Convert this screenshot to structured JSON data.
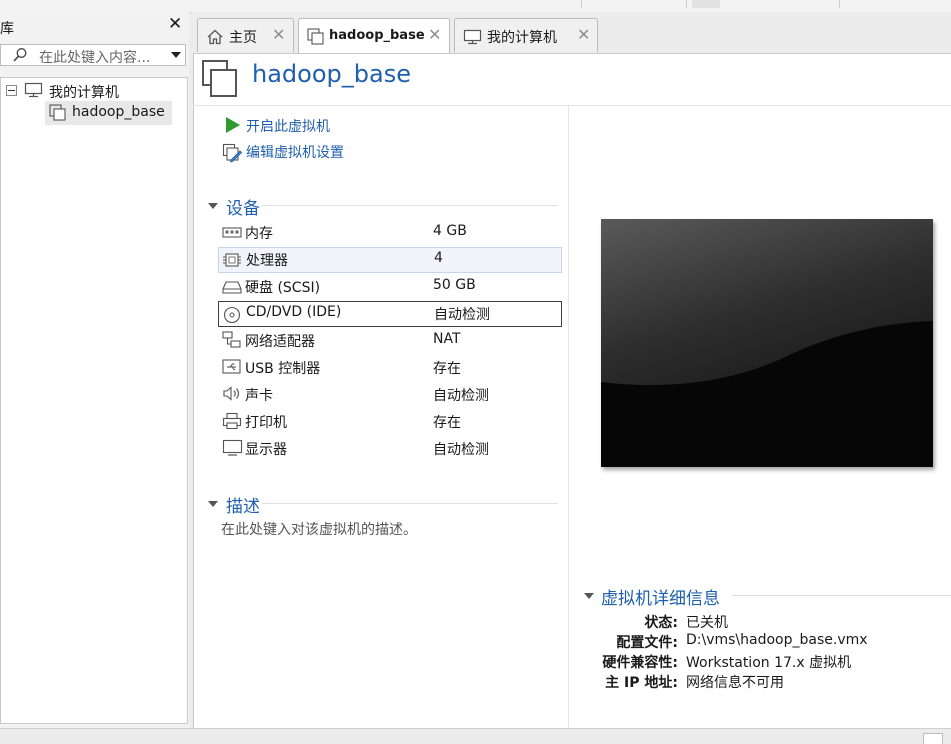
{
  "library": {
    "title": "库",
    "search_placeholder": "在此处键入内容...",
    "tree": {
      "root_label": "我的计算机",
      "children": [
        {
          "label": "hadoop_base"
        }
      ]
    }
  },
  "tabs": [
    {
      "label": "主页",
      "icon": "home-icon",
      "active": false
    },
    {
      "label": "hadoop_base",
      "icon": "vm-icon",
      "active": true
    },
    {
      "label": "我的计算机",
      "icon": "computer-icon",
      "active": false
    }
  ],
  "vm": {
    "title": "hadoop_base",
    "actions": {
      "start": "开启此虚拟机",
      "edit": "编辑虚拟机设置"
    },
    "devices_section": "设备",
    "devices": [
      {
        "name": "内存",
        "value": "4 GB",
        "icon": "memory-icon"
      },
      {
        "name": "处理器",
        "value": "4",
        "icon": "processor-icon"
      },
      {
        "name": "硬盘 (SCSI)",
        "value": "50 GB",
        "icon": "harddisk-icon"
      },
      {
        "name": "CD/DVD (IDE)",
        "value": "自动检测",
        "icon": "cd-icon"
      },
      {
        "name": "网络适配器",
        "value": "NAT",
        "icon": "network-icon"
      },
      {
        "name": "USB 控制器",
        "value": "存在",
        "icon": "usb-icon"
      },
      {
        "name": "声卡",
        "value": "自动检测",
        "icon": "sound-icon"
      },
      {
        "name": "打印机",
        "value": "存在",
        "icon": "printer-icon"
      },
      {
        "name": "显示器",
        "value": "自动检测",
        "icon": "display-icon"
      }
    ],
    "description_section": "描述",
    "description_placeholder": "在此处键入对该虚拟机的描述。",
    "details_section": "虚拟机详细信息",
    "details": [
      {
        "key": "状态:",
        "value": "已关机"
      },
      {
        "key": "配置文件:",
        "value": "D:\\vms\\hadoop_base.vmx"
      },
      {
        "key": "硬件兼容性:",
        "value": "Workstation 17.x 虚拟机"
      },
      {
        "key": "主 IP 地址:",
        "value": "网络信息不可用"
      }
    ]
  },
  "colors": {
    "link_blue": "#1f5fad",
    "start_green": "#2f9a2f"
  }
}
